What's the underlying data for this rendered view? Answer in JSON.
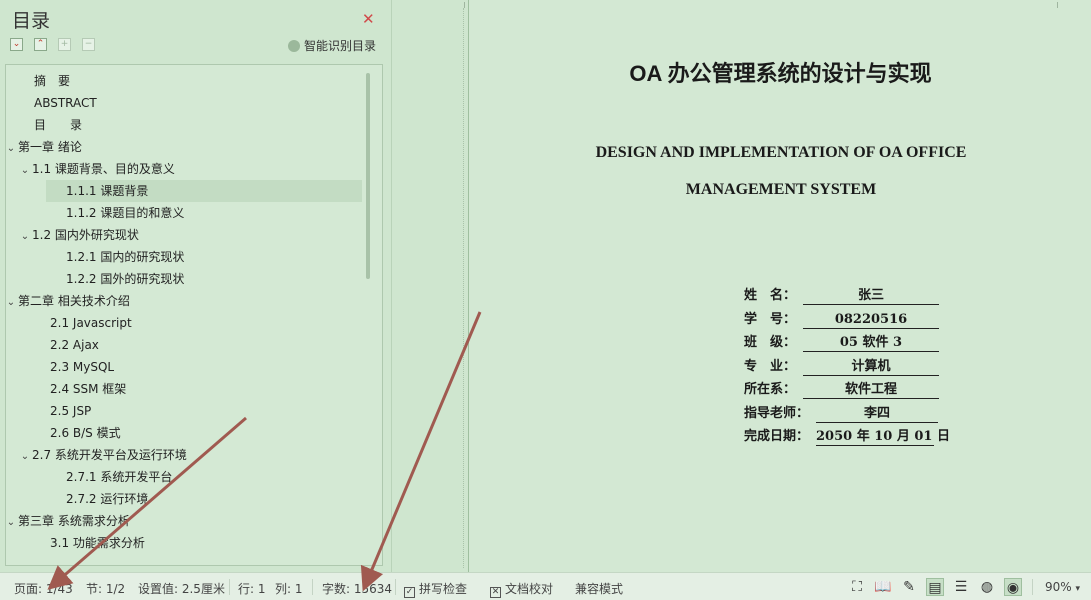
{
  "toc": {
    "title": "目录",
    "smart_label": "智能识别目录",
    "toolbar": {
      "collapse": "⌄",
      "expand": "⌃",
      "add": "+",
      "remove": "−"
    },
    "items": [
      {
        "label": "摘　要",
        "chevron": ""
      },
      {
        "label": "ABSTRACT",
        "chevron": ""
      },
      {
        "label": "目　　录",
        "chevron": ""
      },
      {
        "label": "第一章  绪论",
        "chevron": "⌄"
      },
      {
        "label": "1.1  课题背景、目的及意义",
        "chevron": "⌄"
      },
      {
        "label": "1.1.1  课题背景",
        "chevron": "",
        "selected": true
      },
      {
        "label": "1.1.2  课题目的和意义",
        "chevron": ""
      },
      {
        "label": "1.2  国内外研究现状",
        "chevron": "⌄"
      },
      {
        "label": "1.2.1  国内的研究现状",
        "chevron": ""
      },
      {
        "label": "1.2.2  国外的研究现状",
        "chevron": ""
      },
      {
        "label": "第二章  相关技术介绍",
        "chevron": "⌄"
      },
      {
        "label": "2.1 Javascript",
        "chevron": ""
      },
      {
        "label": "2.2 Ajax",
        "chevron": ""
      },
      {
        "label": "2.3 MySQL",
        "chevron": ""
      },
      {
        "label": "2.4 SSM 框架",
        "chevron": ""
      },
      {
        "label": "2.5 JSP",
        "chevron": ""
      },
      {
        "label": "2.6 B/S 模式",
        "chevron": ""
      },
      {
        "label": "2.7  系统开发平台及运行环境",
        "chevron": "⌄"
      },
      {
        "label": "2.7.1  系统开发平台",
        "chevron": ""
      },
      {
        "label": "2.7.2  运行环境",
        "chevron": ""
      },
      {
        "label": "第三章  系统需求分析",
        "chevron": "⌄"
      },
      {
        "label": "3.1  功能需求分析",
        "chevron": ""
      }
    ]
  },
  "document": {
    "title": "OA 办公管理系统的设计与实现",
    "en_title_line1": "DESIGN AND IMPLEMENTATION OF OA OFFICE",
    "en_title_line2": "MANAGEMENT SYSTEM",
    "info": [
      {
        "label": "姓　名：",
        "value": "张三"
      },
      {
        "label": "学　号：",
        "value": "08220516"
      },
      {
        "label": "班　级：",
        "value": "05 软件 3"
      },
      {
        "label": "专　业：",
        "value": "计算机"
      },
      {
        "label": "所在系：",
        "value": "软件工程"
      },
      {
        "label": "指导老师：",
        "value": "李四"
      },
      {
        "label": "完成日期：",
        "value": "2050 年 10 月 01 日"
      }
    ]
  },
  "status_bar": {
    "page": "页面: 1/43",
    "section": "节: 1/2",
    "setting": "设置值: 2.5厘米",
    "line": "行: 1",
    "column": "列: 1",
    "word_count": "字数: 15634",
    "spell_check": "拼写检查",
    "doc_proof": "文档校对",
    "compat_mode": "兼容模式",
    "zoom": "90%"
  },
  "colors": {
    "annotation_arrow": "#a05a50",
    "close_icon": "#d04a4a"
  }
}
